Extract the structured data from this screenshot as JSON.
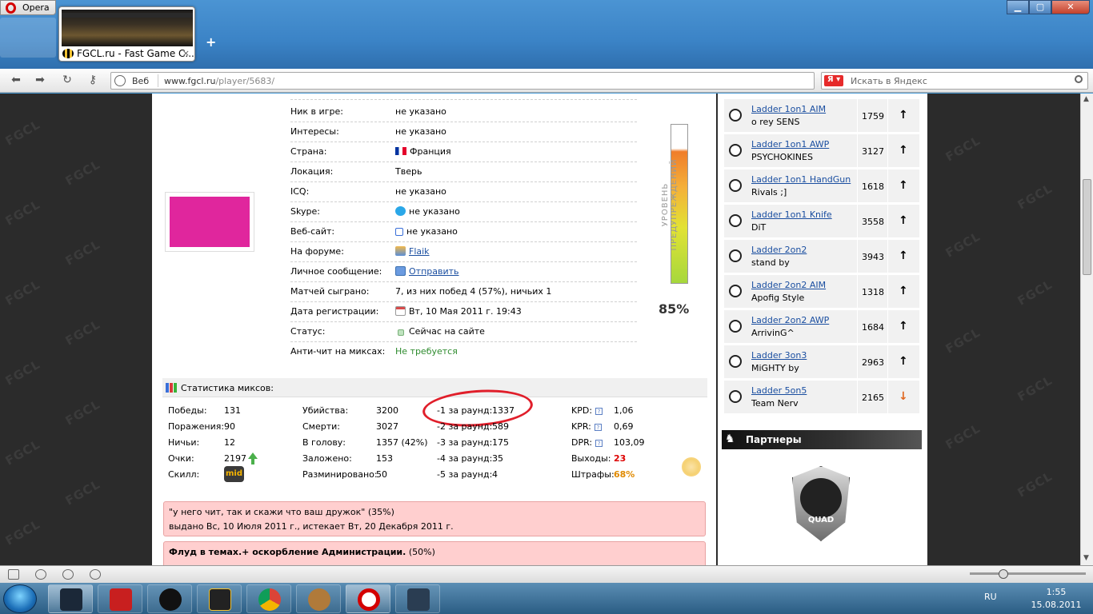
{
  "browser": {
    "menu_label": "Opera",
    "tab_title": "FGCL.ru - Fast Game C...",
    "tab_close": "×",
    "new_tab": "+",
    "address_prefix": "Веб",
    "address_host": "www.fgcl.ru",
    "address_path": "/player/5683/",
    "search_engine_badge": "Я ▾",
    "search_placeholder": "Искать в Яндекс"
  },
  "profile": {
    "rows": [
      {
        "label": "Ник в игре:",
        "value": "не указано"
      },
      {
        "label": "Интересы:",
        "value": "не указано"
      },
      {
        "label": "Страна:",
        "value": "Франция"
      },
      {
        "label": "Локация:",
        "value": "Тверь"
      },
      {
        "label": "ICQ:",
        "value": "не указано"
      },
      {
        "label": "Skype:",
        "value": "не указано"
      },
      {
        "label": "Веб-сайт:",
        "value": "не указано"
      },
      {
        "label": "На форуме:",
        "value": "Flaik"
      },
      {
        "label": "Личное сообщение:",
        "value": "Отправить"
      },
      {
        "label": "Матчей сыграно:",
        "value": "7, из них побед 4 (57%), ничьих 1"
      },
      {
        "label": "Дата регистрации:",
        "value": "Вт, 10 Мая 2011 г. 19:43"
      },
      {
        "label": "Статус:",
        "value": "Сейчас на сайте"
      },
      {
        "label": "Анти-чит на миксах:",
        "value": "Не требуется"
      }
    ],
    "avatar_color": "#e0269d",
    "warning_label": "УРОВЕНЬ ПРЕДУПРЕЖДЕНИЙ",
    "warning_percent": "85%",
    "warning_level": 0.85
  },
  "stats": {
    "title": "Статистика миксов:",
    "col1": [
      {
        "label": "Победы:",
        "value": "131"
      },
      {
        "label": "Поражения:",
        "value": "90"
      },
      {
        "label": "Ничьи:",
        "value": "12"
      },
      {
        "label": "Очки:",
        "value": "2197"
      },
      {
        "label": "Скилл:",
        "value": "mid"
      }
    ],
    "col2": [
      {
        "label": "Убийства:",
        "value": "3200"
      },
      {
        "label": "Смерти:",
        "value": "3027"
      },
      {
        "label": "В голову:",
        "value": "1357 (42%)"
      },
      {
        "label": "Заложено:",
        "value": "153"
      },
      {
        "label": "Разминировано:",
        "value": "50"
      }
    ],
    "col3": [
      {
        "label": "-1 за раунд:",
        "value": "1337"
      },
      {
        "label": "-2 за раунд:",
        "value": "589"
      },
      {
        "label": "-3 за раунд:",
        "value": "175"
      },
      {
        "label": "-4 за раунд:",
        "value": "35"
      },
      {
        "label": "-5 за раунд:",
        "value": "4"
      }
    ],
    "col4": [
      {
        "label": "KPD:",
        "value": "1,06"
      },
      {
        "label": "KPR:",
        "value": "0,69"
      },
      {
        "label": "DPR:",
        "value": "103,09"
      },
      {
        "label": "Выходы:",
        "value": "23"
      },
      {
        "label": "Штрафы:",
        "value": "68%"
      }
    ],
    "help_mark": "?"
  },
  "bans": [
    {
      "reason": "\"у него чит, так и скажи что ваш дружок\"",
      "pct": "(35%)",
      "issued": "выдано Вс, 10 Июля 2011 г., истекает Вт, 20 Декабря 2011 г."
    },
    {
      "reason": "Флуд в темах.+ оскорбление Администрации.",
      "pct": "(50%)"
    }
  ],
  "ladders": [
    {
      "name": "Ladder 1on1 AIM",
      "leader": "o rey SENS",
      "score": "1759",
      "trend": "up"
    },
    {
      "name": "Ladder 1on1 AWP",
      "leader": "PSYCHOKINES",
      "score": "3127",
      "trend": "up"
    },
    {
      "name": "Ladder 1on1 HandGun",
      "leader": "Rivals ;]",
      "score": "1618",
      "trend": "up"
    },
    {
      "name": "Ladder 1on1 Knife",
      "leader": "DiT",
      "score": "3558",
      "trend": "up"
    },
    {
      "name": "Ladder 2on2",
      "leader": "stand by",
      "score": "3943",
      "trend": "up"
    },
    {
      "name": "Ladder 2on2 AIM",
      "leader": "Apofig Style",
      "score": "1318",
      "trend": "up"
    },
    {
      "name": "Ladder 2on2 AWP",
      "leader": "ArrivinG^",
      "score": "1684",
      "trend": "up"
    },
    {
      "name": "Ladder 3on3",
      "leader": "MiGHTY by",
      "score": "2963",
      "trend": "up"
    },
    {
      "name": "Ladder 5on5",
      "leader": "Team Nerv",
      "score": "2165",
      "trend": "down"
    }
  ],
  "partners": {
    "title": "Партнеры",
    "logo_text": "QUAD"
  },
  "taskbar": {
    "lang": "RU",
    "time": "1:55",
    "date": "15.08.2011"
  }
}
